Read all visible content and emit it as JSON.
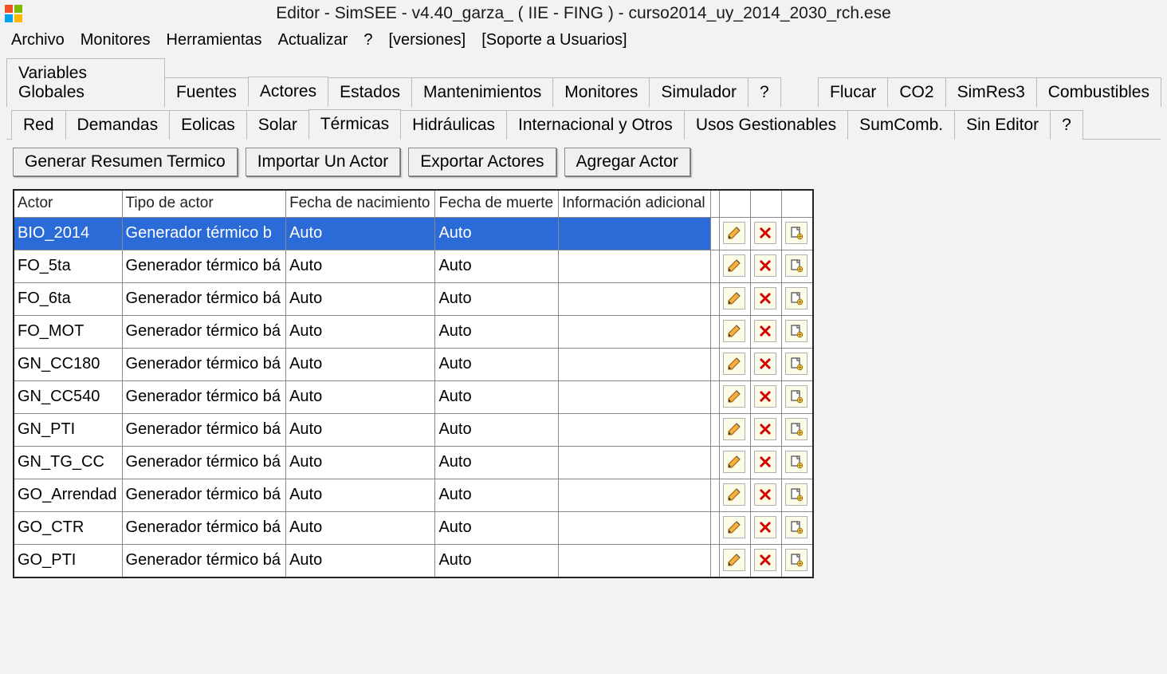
{
  "window": {
    "title": "Editor - SimSEE - v4.40_garza_ ( IIE - FING ) - curso2014_uy_2014_2030_rch.ese"
  },
  "menubar": {
    "items": [
      "Archivo",
      "Monitores",
      "Herramientas",
      "Actualizar",
      "?",
      "[versiones]",
      "[Soporte a Usuarios]"
    ]
  },
  "tabs_top": {
    "items": [
      "Variables Globales",
      "Fuentes",
      "Actores",
      "Estados",
      "Mantenimientos",
      "Monitores",
      "Simulador",
      "?",
      "Flucar",
      "CO2",
      "SimRes3",
      "Combustibles"
    ],
    "active": "Actores"
  },
  "tabs_sub": {
    "items": [
      "Red",
      "Demandas",
      "Eolicas",
      "Solar",
      "Térmicas",
      "Hidráulicas",
      "Internacional y Otros",
      "Usos Gestionables",
      "SumComb.",
      "Sin Editor",
      "?"
    ],
    "active": "Térmicas"
  },
  "buttons": {
    "generar": "Generar Resumen Termico",
    "importar": "Importar Un Actor",
    "exportar": "Exportar Actores",
    "agregar": "Agregar Actor"
  },
  "table": {
    "headers": {
      "actor": "Actor",
      "tipo": "Tipo de actor",
      "nac": "Fecha de nacimiento",
      "mue": "Fecha de muerte",
      "info": "Información adicional"
    },
    "rows": [
      {
        "actor": "BIO_2014",
        "tipo": "Generador térmico b",
        "nac": "Auto",
        "mue": "Auto",
        "info": "",
        "selected": true
      },
      {
        "actor": "FO_5ta",
        "tipo": "Generador térmico bá",
        "nac": "Auto",
        "mue": "Auto",
        "info": ""
      },
      {
        "actor": "FO_6ta",
        "tipo": "Generador térmico bá",
        "nac": "Auto",
        "mue": "Auto",
        "info": ""
      },
      {
        "actor": "FO_MOT",
        "tipo": "Generador térmico bá",
        "nac": "Auto",
        "mue": "Auto",
        "info": ""
      },
      {
        "actor": "GN_CC180",
        "tipo": "Generador térmico bá",
        "nac": "Auto",
        "mue": "Auto",
        "info": ""
      },
      {
        "actor": "GN_CC540",
        "tipo": "Generador térmico bá",
        "nac": "Auto",
        "mue": "Auto",
        "info": ""
      },
      {
        "actor": "GN_PTI",
        "tipo": "Generador térmico bá",
        "nac": "Auto",
        "mue": "Auto",
        "info": ""
      },
      {
        "actor": "GN_TG_CC",
        "tipo": "Generador térmico bá",
        "nac": "Auto",
        "mue": "Auto",
        "info": ""
      },
      {
        "actor": "GO_Arrendad",
        "tipo": "Generador térmico bá",
        "nac": "Auto",
        "mue": "Auto",
        "info": ""
      },
      {
        "actor": "GO_CTR",
        "tipo": "Generador térmico bá",
        "nac": "Auto",
        "mue": "Auto",
        "info": ""
      },
      {
        "actor": "GO_PTI",
        "tipo": "Generador térmico bá",
        "nac": "Auto",
        "mue": "Auto",
        "info": ""
      }
    ]
  }
}
